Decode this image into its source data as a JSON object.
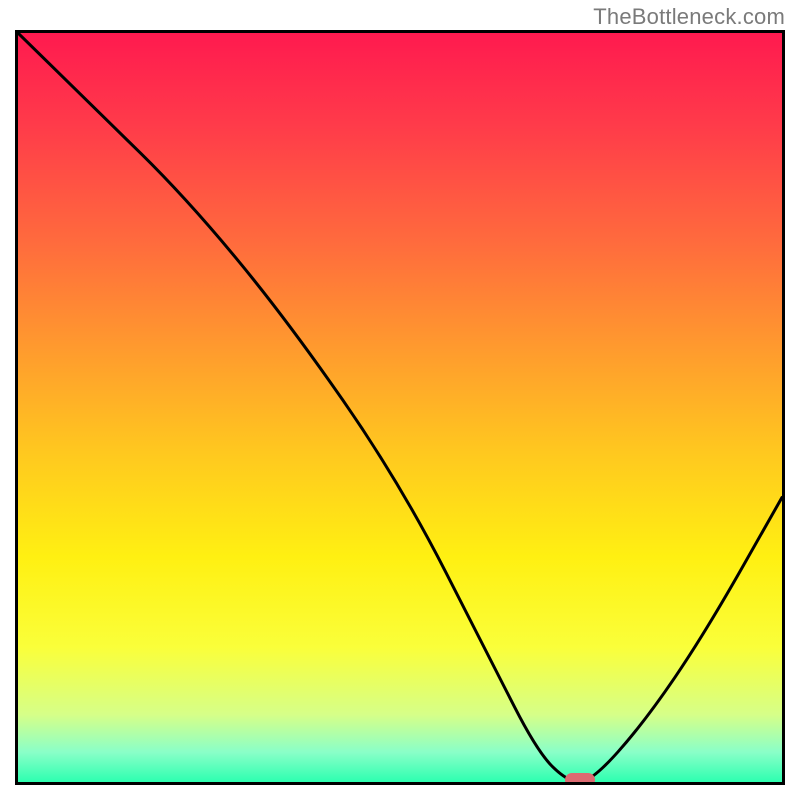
{
  "watermark": "TheBottleneck.com",
  "chart_data": {
    "type": "line",
    "title": "",
    "xlabel": "",
    "ylabel": "",
    "xlim": [
      0,
      100
    ],
    "ylim": [
      0,
      100
    ],
    "grid": false,
    "series": [
      {
        "name": "curve",
        "x": [
          0,
          10,
          22,
          35,
          50,
          62,
          68,
          72,
          75,
          82,
          90,
          100
        ],
        "y": [
          100,
          90,
          78,
          62,
          40,
          16,
          4,
          0,
          0,
          8,
          20,
          38
        ]
      }
    ],
    "marker": {
      "x": 73,
      "y": 0,
      "color": "#dd6a71"
    },
    "background_gradient": [
      {
        "stop": 0.0,
        "color": "#ff1a4f"
      },
      {
        "stop": 0.28,
        "color": "#ff6b3d"
      },
      {
        "stop": 0.56,
        "color": "#ffc81f"
      },
      {
        "stop": 0.82,
        "color": "#faff3a"
      },
      {
        "stop": 1.0,
        "color": "#2dffb0"
      }
    ]
  }
}
